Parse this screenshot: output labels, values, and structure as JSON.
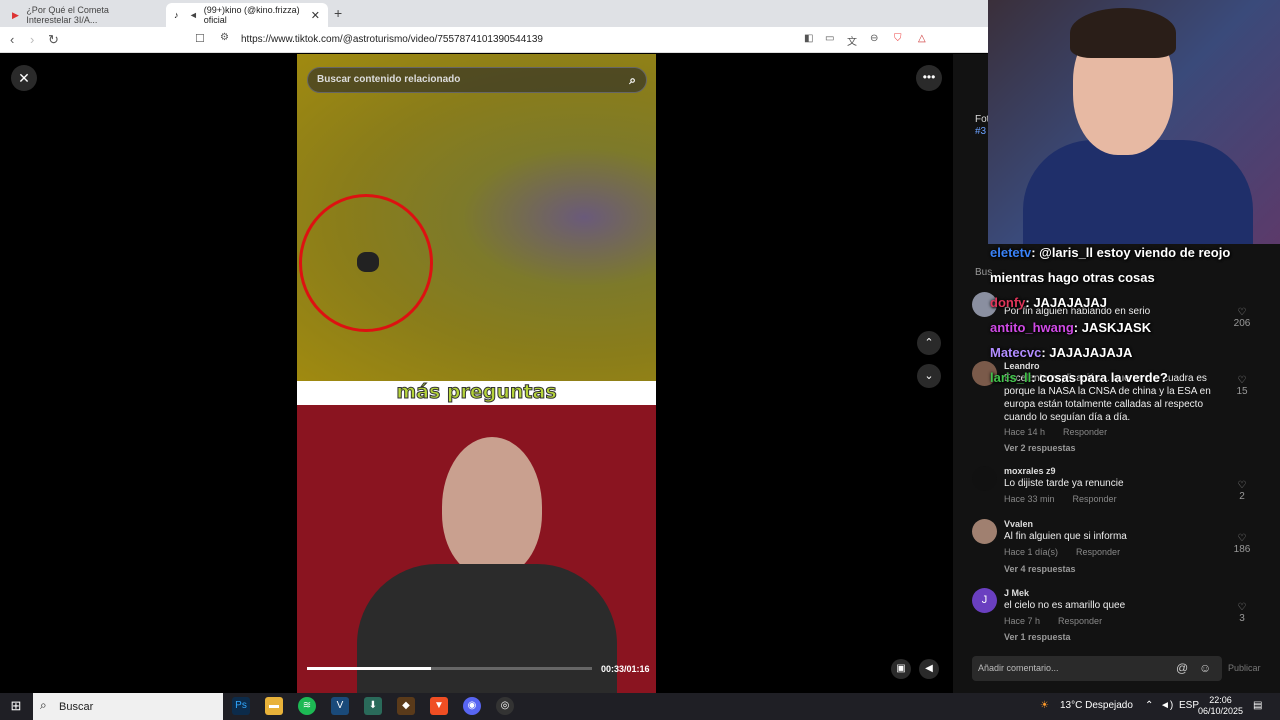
{
  "browser": {
    "tabs": [
      {
        "label": "¿Por Qué el Cometa Interestelar 3I/A..."
      },
      {
        "label": "(99+)kino (@kino.frizza) oficial",
        "active": true
      }
    ],
    "url": "https://www.tiktok.com/@astroturismo/video/7557874101390544139"
  },
  "video": {
    "search_placeholder": "Buscar contenido relacionado",
    "caption": "más preguntas",
    "time": "00:33/01:16",
    "progress": 0.434
  },
  "chat": [
    {
      "user": "eletetv",
      "text": ": @laris_ll estoy viendo de reojo mientras hago otras cosas",
      "color": "#3a82f7"
    },
    {
      "user": "donfy",
      "text": ": JAJAJAJAJ",
      "color": "#e0365a"
    },
    {
      "user": "antito_hwang",
      "text": ": JASKJASK",
      "color": "#d04ae6"
    },
    {
      "user": "Matecvc",
      "text": ": JAJAJAJAJA",
      "color": "#b18cff"
    },
    {
      "user": "laris_ll",
      "text": ": cosas para la verde?",
      "color": "#41c24a"
    }
  ],
  "side_preview": {
    "line1": "Fot",
    "line2": "#3",
    "label": "Bus"
  },
  "comments": [
    {
      "user": "",
      "text": "Por fin alguien hablando en serio",
      "likes": "206"
    },
    {
      "user": "Leandro",
      "text": "Excelente explicación… que no me cuadra es porque la NASA la CNSA de china y la ESA en europa están totalmente calladas al respecto cuando lo seguían día a día.",
      "time": "Hace 14 h",
      "reply": "Responder",
      "more": "Ver 2 respuestas",
      "likes": "15"
    },
    {
      "user": "moxrales z9",
      "text": "Lo dijiste tarde ya renuncie",
      "time": "Hace 33 min",
      "reply": "Responder",
      "likes": "2"
    },
    {
      "user": "Vvalen",
      "text": "Al fin alguien que si informa",
      "time": "Hace 1 día(s)",
      "reply": "Responder",
      "more": "Ver 4 respuestas",
      "likes": "186"
    },
    {
      "user": "J Mek",
      "text": "el cielo no es amarillo quee",
      "time": "Hace 7 h",
      "reply": "Responder",
      "more": "Ver 1 respuesta",
      "likes": "3"
    }
  ],
  "comment_input": {
    "placeholder": "Añadir comentario...",
    "submit": "Publicar"
  },
  "taskbar": {
    "search": "Buscar",
    "weather": "13°C  Despejado",
    "lang": "ESP",
    "time": "22:06",
    "date": "06/10/2025"
  }
}
